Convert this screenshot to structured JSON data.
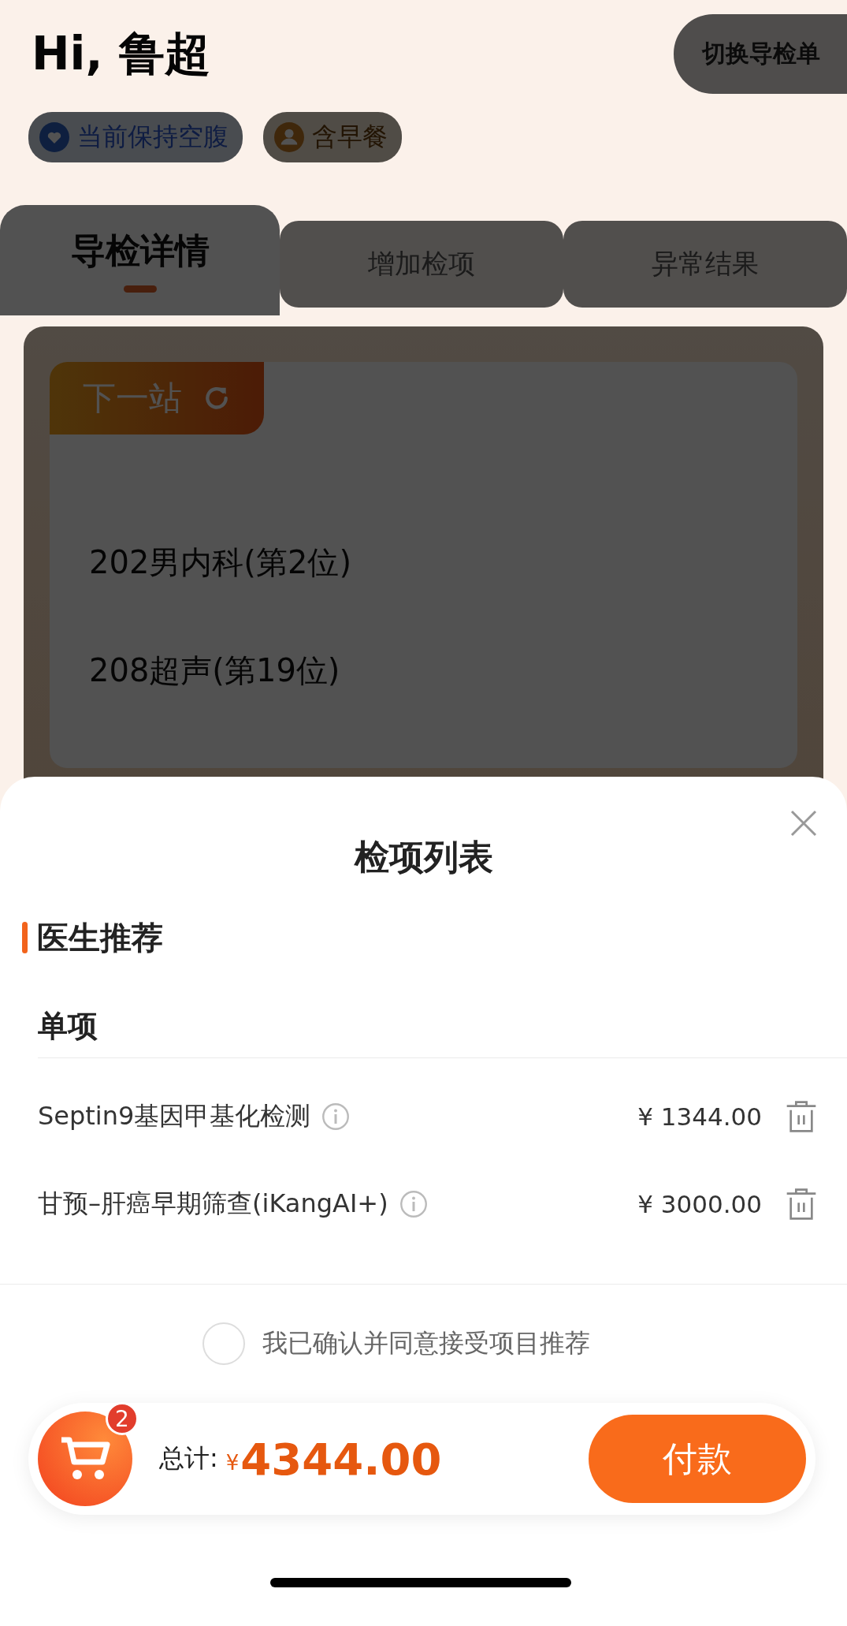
{
  "header": {
    "greeting": "Hi, 鲁超",
    "switch_button": "切换导检单"
  },
  "tags": [
    {
      "kind": "fasting",
      "label": "当前保持空腹"
    },
    {
      "kind": "meal",
      "label": "含早餐"
    }
  ],
  "tabs": [
    {
      "label": "导检详情",
      "selected": true
    },
    {
      "label": "增加检项",
      "selected": false
    },
    {
      "label": "异常结果",
      "selected": false
    }
  ],
  "next_station": {
    "title": "下一站",
    "stops": [
      "202男内科(第2位)",
      "208超声(第19位)"
    ]
  },
  "sheet": {
    "title": "检项列表",
    "section": "医生推荐",
    "group": "单项",
    "items": [
      {
        "name": "Septin9基因甲基化检测",
        "price": "¥ 1344.00"
      },
      {
        "name": "甘预–肝癌早期筛查(iKangAI+)",
        "price": "¥ 3000.00"
      }
    ],
    "agreement": {
      "label": "我已确认并同意接受项目推荐",
      "checked": false
    }
  },
  "checkout": {
    "cart_count": "2",
    "total_label": "总计:",
    "currency": "¥",
    "total": "4344.00",
    "pay_button": "付款"
  }
}
